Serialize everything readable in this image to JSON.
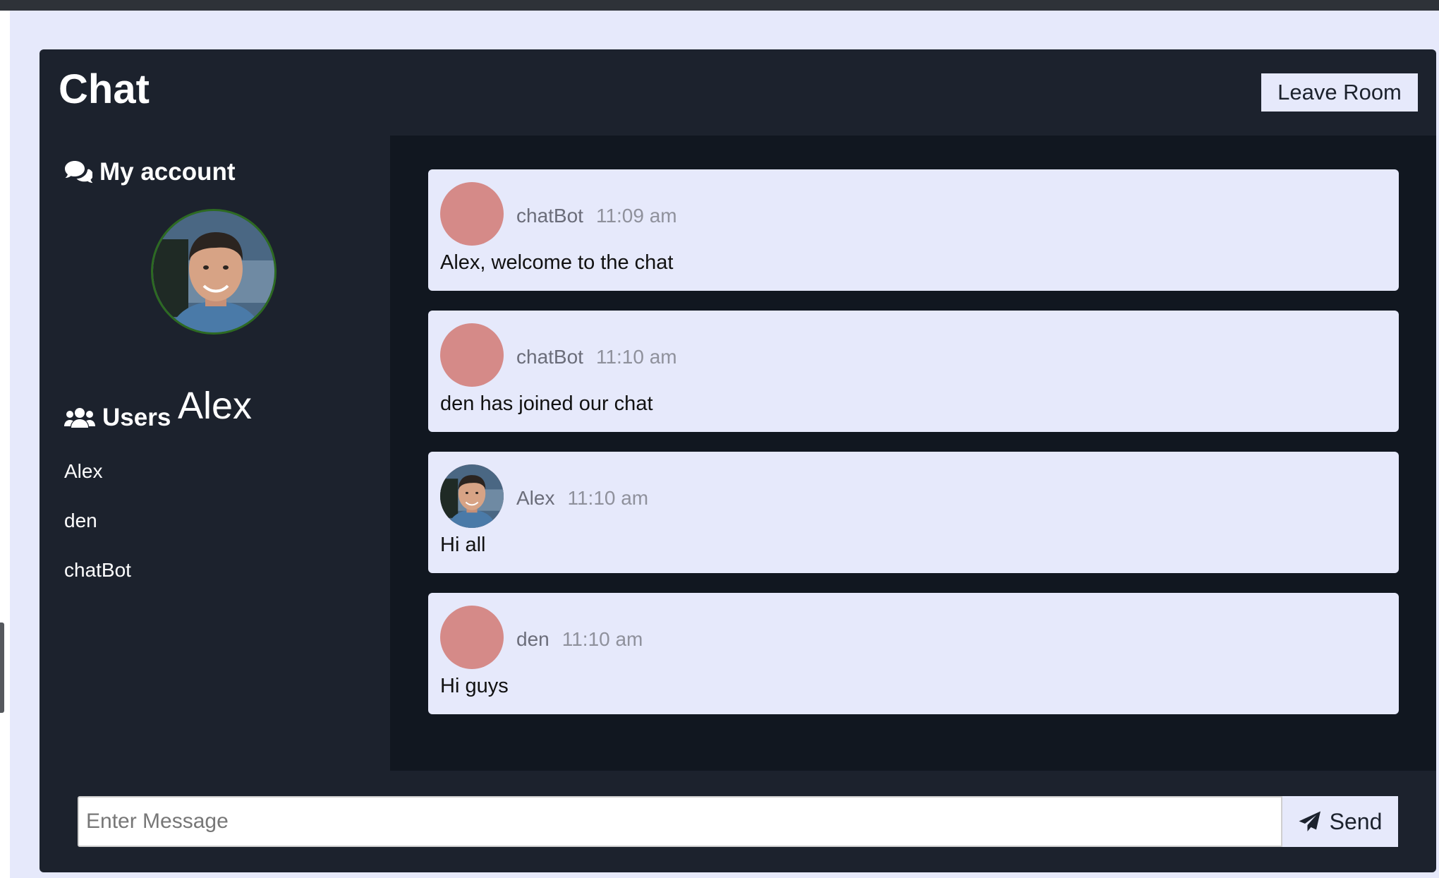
{
  "header": {
    "title": "Chat",
    "leave_label": "Leave Room"
  },
  "sidebar": {
    "account_heading": "My account",
    "current_user": "Alex",
    "users_heading": "Users",
    "users": [
      "Alex",
      "den",
      "chatBot"
    ]
  },
  "messages": [
    {
      "user": "chatBot",
      "time": "11:09 am",
      "text": "Alex, welcome to the chat",
      "avatar": "placeholder"
    },
    {
      "user": "chatBot",
      "time": "11:10 am",
      "text": "den has joined our chat",
      "avatar": "placeholder"
    },
    {
      "user": "Alex",
      "time": "11:10 am",
      "text": "Hi all",
      "avatar": "photo"
    },
    {
      "user": "den",
      "time": "11:10 am",
      "text": "Hi guys",
      "avatar": "placeholder"
    }
  ],
  "composer": {
    "placeholder": "Enter Message",
    "value": "",
    "send_label": "Send"
  },
  "icons": {
    "account": "comments-icon",
    "users": "users-icon",
    "send": "paper-plane-icon"
  },
  "colors": {
    "background": "#e6e9fb",
    "panel": "#1c222d",
    "chat_area": "#111720",
    "avatar_placeholder": "#d58a88"
  }
}
